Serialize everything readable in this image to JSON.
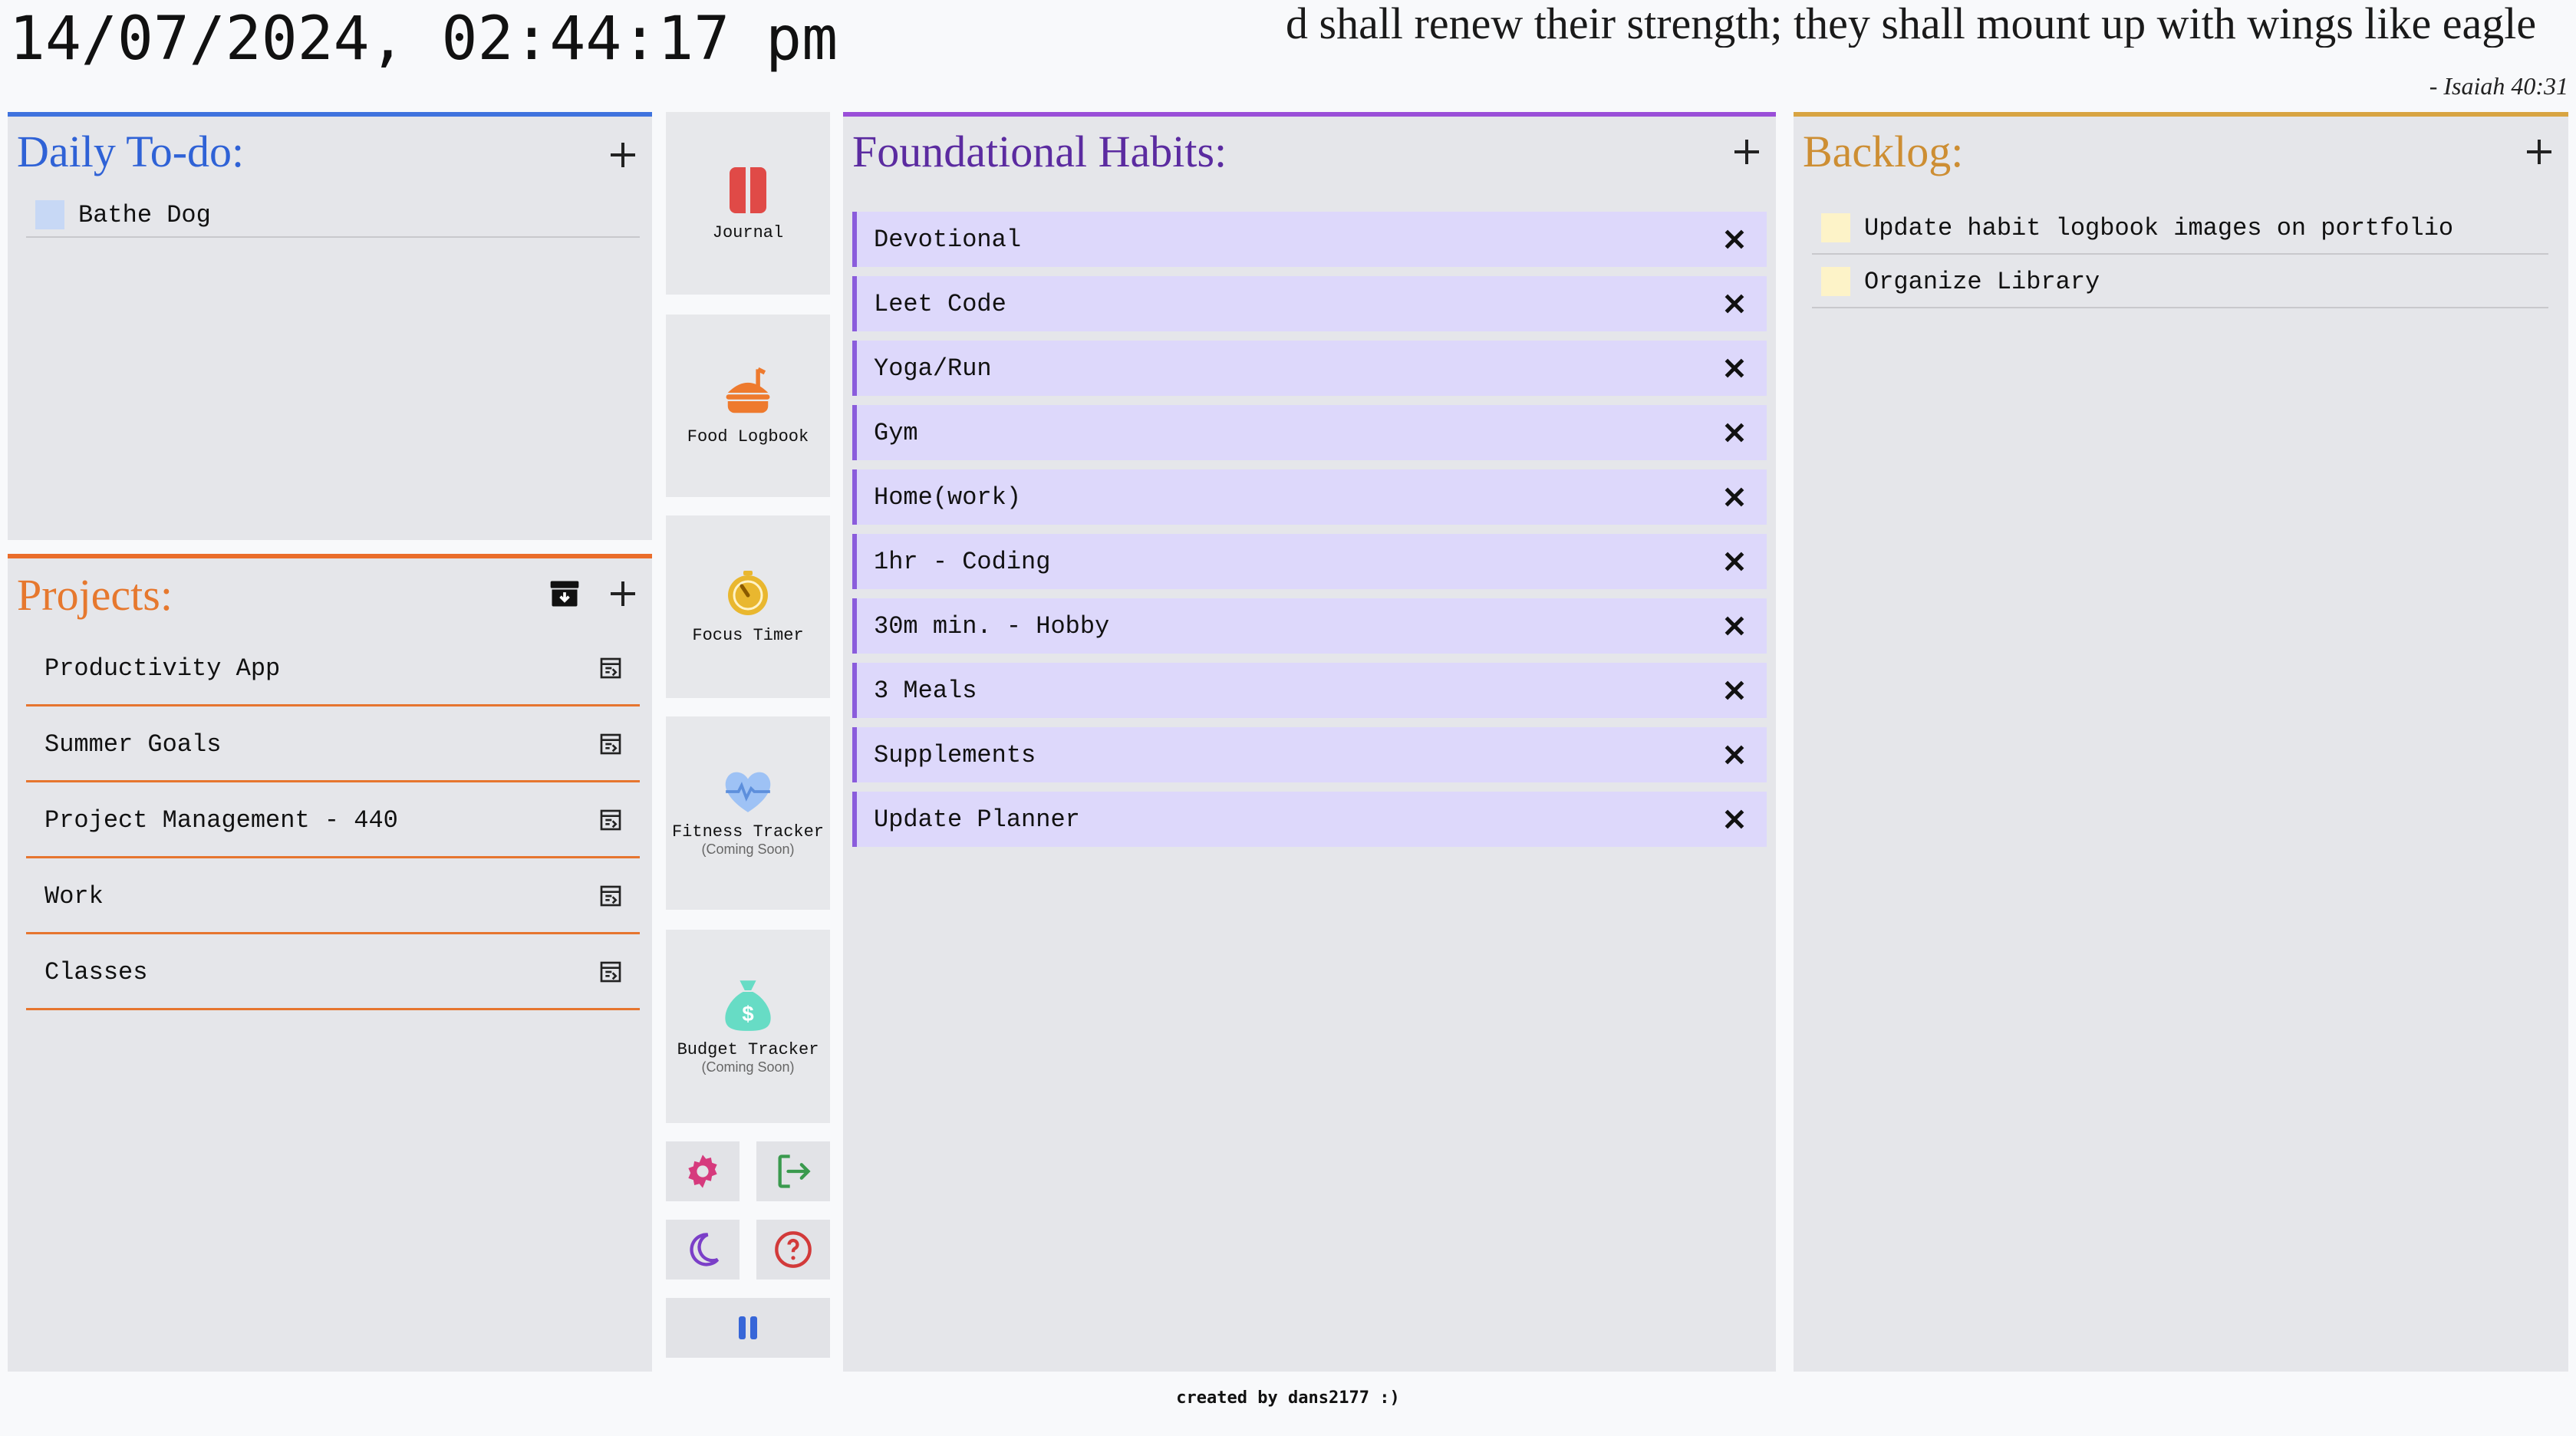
{
  "header": {
    "datetime": "14/07/2024, 02:44:17 pm",
    "verse_text": "d shall renew their strength; they shall mount up with wings like eagle",
    "verse_ref": "- Isaiah 40:31"
  },
  "todo": {
    "title": "Daily To-do:",
    "items": [
      {
        "label": "Bathe Dog",
        "color": "#c7d8f5"
      }
    ]
  },
  "projects": {
    "title": "Projects:",
    "items": [
      {
        "label": "Productivity App"
      },
      {
        "label": "Summer Goals"
      },
      {
        "label": "Project Management - 440"
      },
      {
        "label": "Work"
      },
      {
        "label": "Classes"
      }
    ]
  },
  "nav": {
    "journal": {
      "label": "Journal",
      "icon": "book-icon",
      "color": "#e04a47"
    },
    "food": {
      "label": "Food Logbook",
      "icon": "food-icon",
      "color": "#ee7a2e"
    },
    "focus": {
      "label": "Focus Timer",
      "icon": "timer-icon",
      "color": "#e9b72f"
    },
    "fitness": {
      "label": "Fitness Tracker",
      "sub": "(Coming Soon)",
      "icon": "heart-pulse-icon",
      "color": "#9ec2f5"
    },
    "budget": {
      "label": "Budget Tracker",
      "sub": "(Coming Soon)",
      "icon": "money-bag-icon",
      "color": "#67dcc5"
    },
    "settings_icon": "gear-icon",
    "logout_icon": "logout-icon",
    "theme_icon": "moon-icon",
    "help_icon": "help-icon",
    "pause_icon": "pause-icon"
  },
  "habits": {
    "title": "Foundational Habits:",
    "items": [
      {
        "label": "Devotional"
      },
      {
        "label": "Leet Code"
      },
      {
        "label": "Yoga/Run"
      },
      {
        "label": "Gym"
      },
      {
        "label": "Home(work)"
      },
      {
        "label": "1hr - Coding"
      },
      {
        "label": "30m min. - Hobby"
      },
      {
        "label": "3 Meals"
      },
      {
        "label": "Supplements"
      },
      {
        "label": "Update Planner"
      }
    ]
  },
  "backlog": {
    "title": "Backlog:",
    "items": [
      {
        "label": "Update habit logbook images on portfolio",
        "color": "#fdf3c8"
      },
      {
        "label": "Organize Library",
        "color": "#fdf3c8"
      }
    ]
  },
  "footer": {
    "text": "created by dans2177 :)"
  },
  "colors": {
    "todo_accent": "#3f73de",
    "projects_accent": "#ea6d2b",
    "habits_accent": "#9a4fd8",
    "backlog_accent": "#d8a442"
  }
}
